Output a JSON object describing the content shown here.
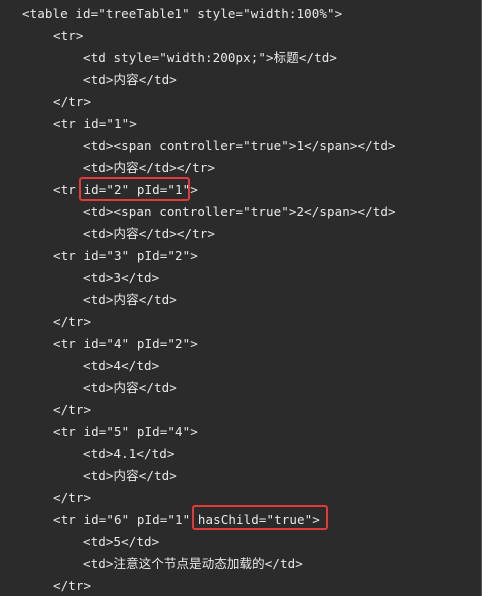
{
  "code": {
    "lines": [
      "<table id=\"treeTable1\" style=\"width:100%\">",
      "<tr>",
      "<td style=\"width:200px;\">标题</td>",
      "<td>内容</td>",
      "</tr>",
      "<tr id=\"1\">",
      "<td><span controller=\"true\">1</span></td>",
      "<td>内容</td></tr>",
      "<tr id=\"2\" pId=\"1\">",
      "<td><span controller=\"true\">2</span></td>",
      "<td>内容</td></tr>",
      "<tr id=\"3\" pId=\"2\">",
      "<td>3</td>",
      "<td>内容</td>",
      "</tr>",
      "<tr id=\"4\" pId=\"2\">",
      "<td>4</td>",
      "<td>内容</td>",
      "</tr>",
      "<tr id=\"5\" pId=\"4\">",
      "<td>4.1</td>",
      "<td>内容</td>",
      "</tr>",
      "<tr id=\"6\" pId=\"1\" hasChild=\"true\">",
      "<td>5</td>",
      "<td>注意这个节点是动态加载的</td>",
      "</tr>"
    ]
  },
  "colors": {
    "background": "#2b2b2b",
    "text": "#e8e8e8",
    "highlight_border": "#e03a3a"
  }
}
